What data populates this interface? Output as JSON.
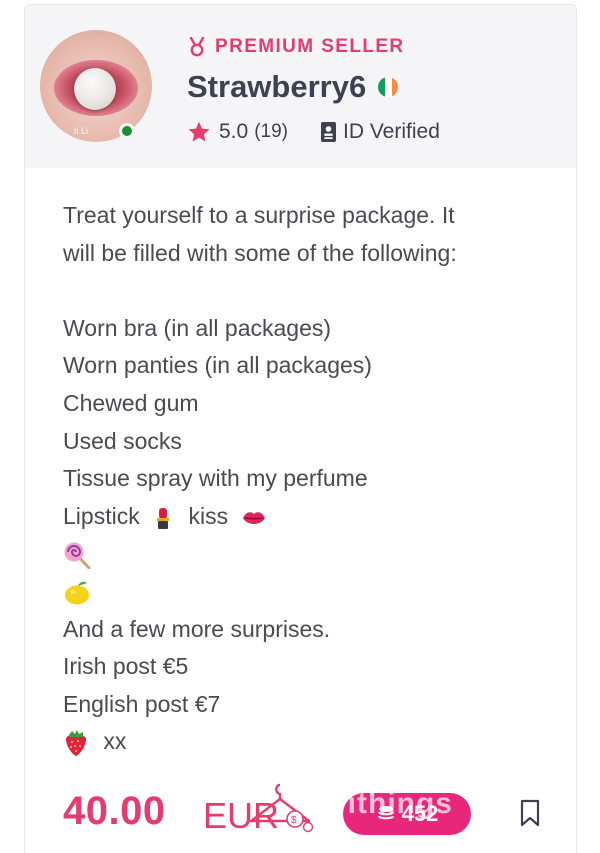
{
  "seller": {
    "badge_label": "PREMIUM SELLER",
    "name": "Strawberry6",
    "rating": "5.0",
    "review_count": "(19)",
    "verified_label": "ID Verified",
    "avatar_watermark": "ti Li"
  },
  "description_lines": [
    "Treat yourself to a surprise package. It",
    "will be filled with some of the following:",
    "",
    "Worn bra (in all packages)",
    "Worn panties (in all packages)",
    "Chewed gum",
    "Used socks",
    "Tissue spray with my perfume",
    "Lipstick",
    "kiss",
    "And a few more surprises.",
    "Irish post €5",
    "English post €7",
    "xx"
  ],
  "listing": {
    "price": "40.00",
    "currency": "EUR",
    "pill_count": "452",
    "watermark": "rithings"
  },
  "colors": {
    "accent": "#e23d6d",
    "pill": "#e8267b",
    "header_bg": "#f5f5f7",
    "online": "#1e8e2f"
  },
  "icons": [
    "medal-icon",
    "ireland-flag-icon",
    "star-icon",
    "id-card-icon",
    "lipstick-emoji",
    "kiss-emoji",
    "lollipop-emoji",
    "lemon-emoji",
    "strawberry-emoji",
    "coin-stack-icon",
    "hanger-icon",
    "bookmark-icon"
  ]
}
